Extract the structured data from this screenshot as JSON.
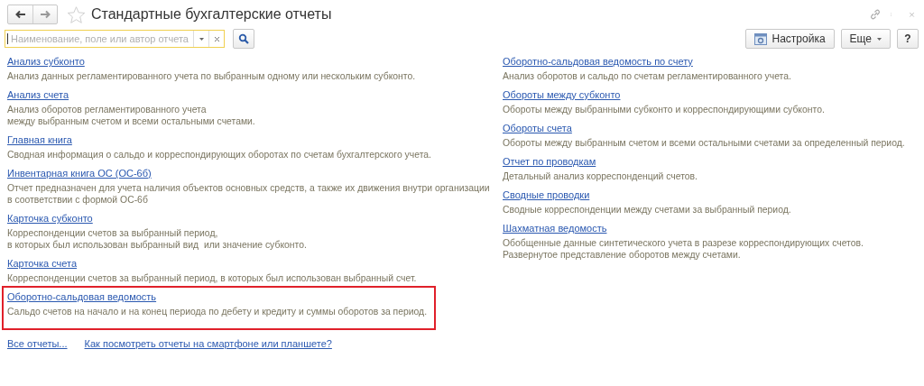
{
  "window": {
    "title": "Стандартные бухгалтерские отчеты",
    "favorite": false
  },
  "search": {
    "placeholder": "Наименование, поле или автор отчета"
  },
  "toolbar": {
    "settings_button": "Настройка",
    "more_button": "Еще",
    "help_button": "?"
  },
  "items_left": [
    {
      "title": "Анализ субконто",
      "description": "Анализ данных регламентированного учета по выбранным одному или нескольким субконто.",
      "highlighted": false
    },
    {
      "title": "Анализ счета",
      "description": "Анализ оборотов регламентированного учета\nмежду выбранным счетом и всеми остальными счетами.",
      "highlighted": false
    },
    {
      "title": "Главная книга",
      "description": "Сводная информация о сальдо и корреспондирующих оборотах по счетам бухгалтерского учета.",
      "highlighted": false
    },
    {
      "title": "Инвентарная книга ОС (ОС-6б)",
      "description": "Отчет предназначен для учета наличия объектов основных средств, а также их движения внутри организации\nв соответствии с формой ОС-6б",
      "highlighted": false
    },
    {
      "title": "Карточка субконто",
      "description": "Корреспонденции счетов за выбранный период,\nв которых был использован выбранный вид  или значение субконто.",
      "highlighted": false
    },
    {
      "title": "Карточка счета",
      "description": "Корреспонденции счетов за выбранный период, в которых был использован выбранный счет.",
      "highlighted": false
    },
    {
      "title": "Оборотно-сальдовая ведомость",
      "description": "Сальдо счетов на начало и на конец периода по дебету и кредиту и суммы оборотов за период.",
      "highlighted": true
    }
  ],
  "items_right": [
    {
      "title": "Оборотно-сальдовая ведомость по счету",
      "description": "Анализ оборотов и сальдо по счетам регламентированного учета.",
      "highlighted": false
    },
    {
      "title": "Обороты между субконто",
      "description": "Обороты между выбранными субконто и корреспондирующими субконто.",
      "highlighted": false
    },
    {
      "title": "Обороты счета",
      "description": "Обороты между выбранным счетом и всеми остальными счетами за определенный период.",
      "highlighted": false
    },
    {
      "title": "Отчет по проводкам",
      "description": "Детальный анализ корреспонденций счетов.",
      "highlighted": false
    },
    {
      "title": "Сводные проводки",
      "description": "Сводные корреспонденции между счетами за выбранный период.",
      "highlighted": false
    },
    {
      "title": "Шахматная ведомость",
      "description": "Обобщенные данные синтетического учета в разрезе корреспондирующих счетов.\nРазвернутое представление оборотов между счетами.",
      "highlighted": false
    }
  ],
  "footer_links": [
    "Все отчеты...",
    "Как посмотреть отчеты на смартфоне или планшете?"
  ]
}
